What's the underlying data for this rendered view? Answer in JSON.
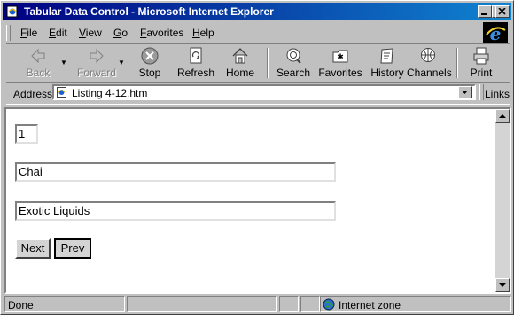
{
  "window": {
    "title": "Tabular Data Control - Microsoft Internet Explorer"
  },
  "menu": [
    {
      "label": "File",
      "underline": "F",
      "rest": "ile"
    },
    {
      "label": "Edit",
      "underline": "E",
      "rest": "dit"
    },
    {
      "label": "View",
      "underline": "V",
      "rest": "iew"
    },
    {
      "label": "Go",
      "underline": "G",
      "rest": "o"
    },
    {
      "label": "Favorites",
      "underline": "F",
      "rest": "avorites"
    },
    {
      "label": "Help",
      "underline": "H",
      "rest": "elp"
    }
  ],
  "toolbar": {
    "back": "Back",
    "forward": "Forward",
    "stop": "Stop",
    "refresh": "Refresh",
    "home": "Home",
    "search": "Search",
    "favorites": "Favorites",
    "history": "History",
    "channels": "Channels",
    "print": "Print"
  },
  "address": {
    "label": "Address",
    "value": "Listing 4-12.htm",
    "links_label": "Links"
  },
  "page": {
    "record_id": "1",
    "product_name": "Chai",
    "supplier": "Exotic Liquids",
    "next_label": "Next",
    "prev_label": "Prev"
  },
  "status": {
    "text": "Done",
    "zone": "Internet zone"
  },
  "colors": {
    "title_start": "#000080",
    "title_end": "#1084d0",
    "chrome": "#c0c0c0"
  }
}
